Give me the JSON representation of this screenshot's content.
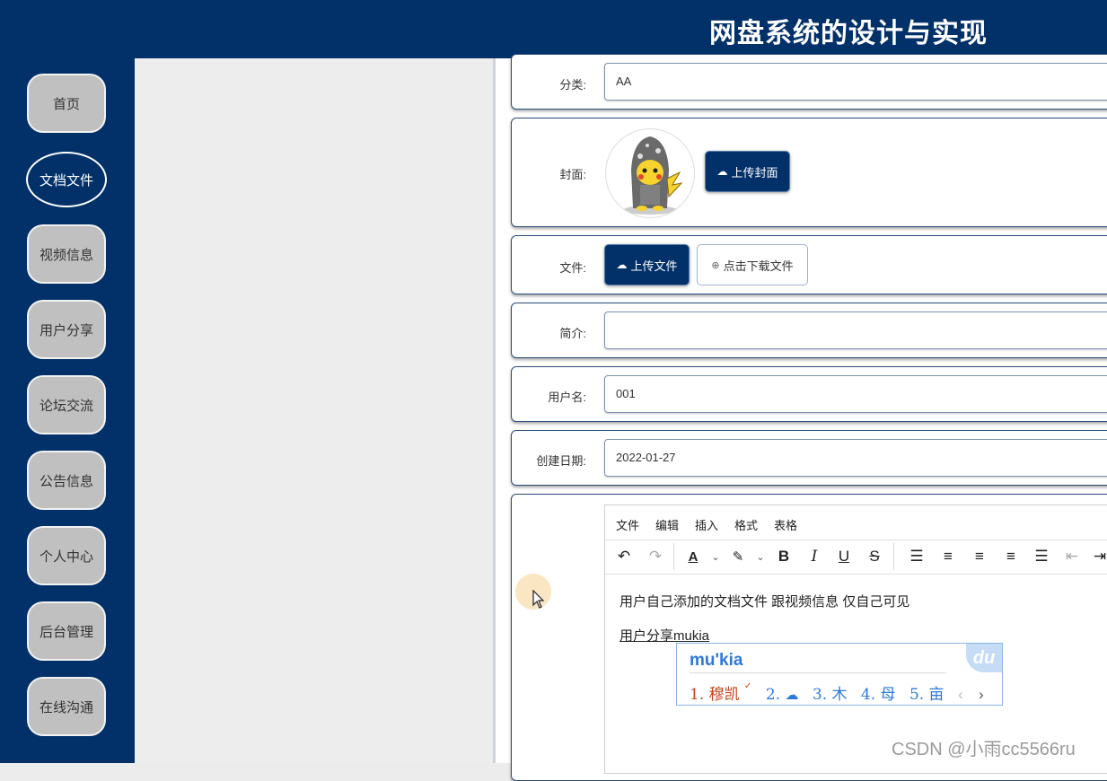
{
  "header": {
    "title": "网盘系统的设计与实现"
  },
  "nav": [
    {
      "label": "首页"
    },
    {
      "label": "文档文件"
    },
    {
      "label": "视频信息"
    },
    {
      "label": "用户分享"
    },
    {
      "label": "论坛交流"
    },
    {
      "label": "公告信息"
    },
    {
      "label": "个人中心"
    },
    {
      "label": "后台管理"
    },
    {
      "label": "在线沟通"
    }
  ],
  "form": {
    "category": {
      "label": "分类:",
      "value": "AA"
    },
    "cover": {
      "label": "封面:",
      "upload_label": "上传封面"
    },
    "file": {
      "label": "文件:",
      "upload_label": "上传文件",
      "download_label": "点击下载文件"
    },
    "intro": {
      "label": "简介:",
      "value": ""
    },
    "username": {
      "label": "用户名:",
      "value": "001"
    },
    "created": {
      "label": "创建日期:",
      "value": "2022-01-27"
    }
  },
  "editor": {
    "menu": [
      "文件",
      "编辑",
      "插入",
      "格式",
      "表格"
    ],
    "line1": "用户自己添加的文档文件 跟视频信息 仅自己可见",
    "line2": "用户分享mukia"
  },
  "ime": {
    "composition": "mu'kia",
    "candidates": [
      "1. 穆凯",
      "2.",
      "3. 木",
      "4. 母",
      "5. 亩"
    ],
    "logo": "du"
  },
  "watermark": "CSDN @小雨cc5566ru",
  "colors": {
    "primary": "#023169",
    "nav_inactive": "#c0c0c0",
    "ime_blue": "#2c79d6",
    "ime_first": "#c9421e"
  }
}
